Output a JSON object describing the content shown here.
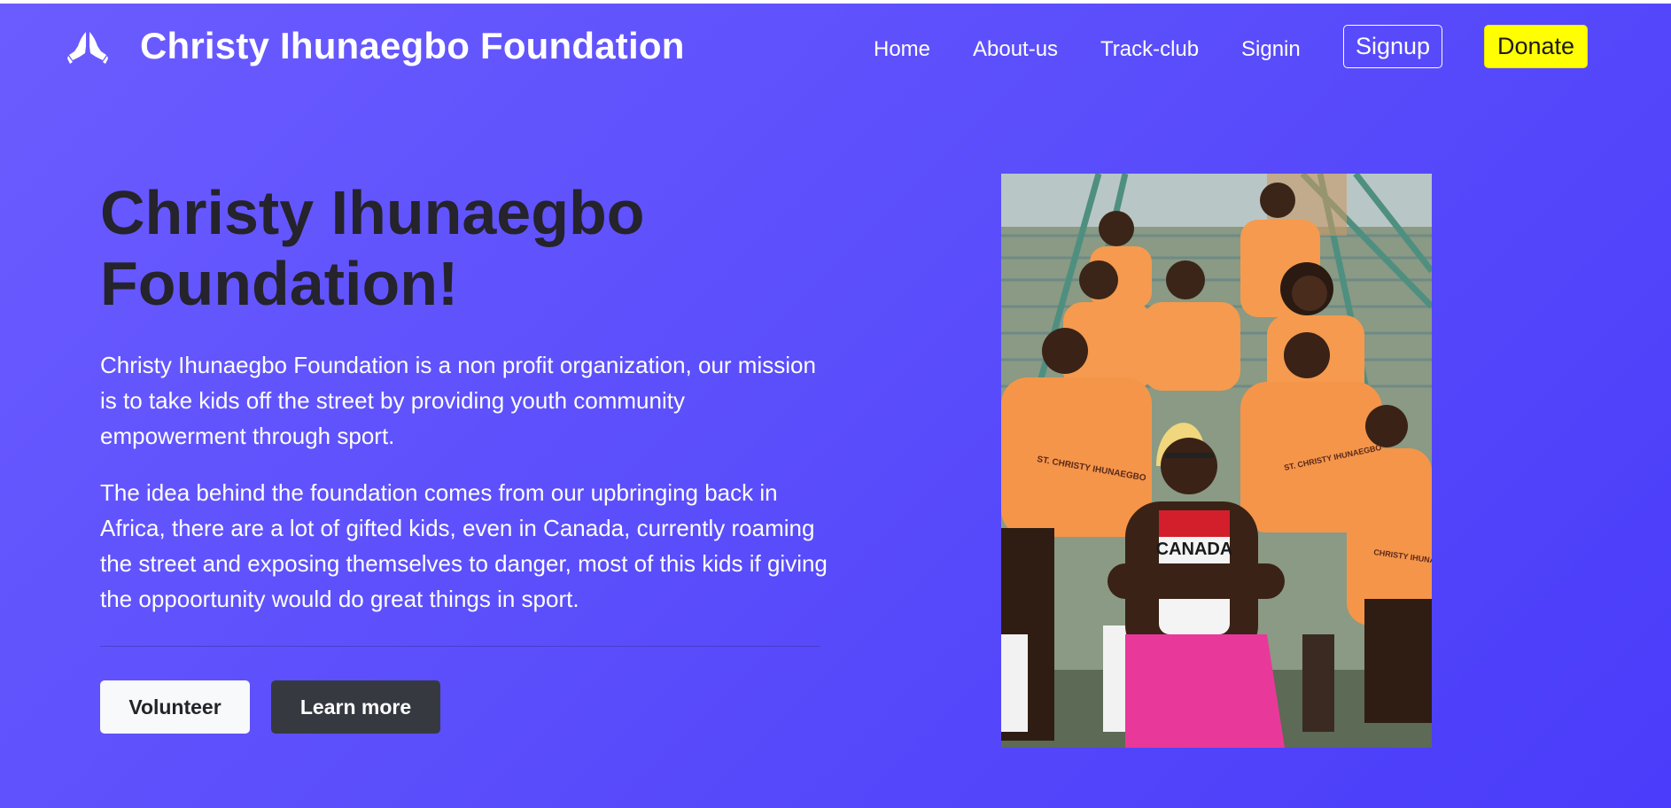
{
  "navbar": {
    "brand_icon": "praying-hands-icon",
    "brand_title": "Christy Ihunaegbo Foundation",
    "links": [
      "Home",
      "About-us",
      "Track-club",
      "Signin"
    ],
    "signup_label": "Signup",
    "donate_label": "Donate"
  },
  "hero": {
    "title": "Christy Ihunaegbo Foundation!",
    "paragraph_1": "Christy Ihunaegbo Foundation is a non profit organization, our mission is to take kids off the street by providing youth community empowerment through sport.",
    "paragraph_2": "The idea behind the foundation comes from our upbringing back in Africa, there are a lot of gifted kids, even in Canada, currently roaming the street and exposing themselves to danger, most of this kids if giving the oppoortunity would do great things in sport.",
    "volunteer_label": "Volunteer",
    "learn_more_label": "Learn more"
  },
  "photo": {
    "shirt_text": "ST. CHRISTY IHUNAEGBO ATHLETICS CLUB",
    "singlet_text": "CANADA"
  },
  "colors": {
    "background_start": "#6b5cff",
    "background_end": "#4a3cfa",
    "donate_bg": "#ffff00",
    "title_color": "#25232b",
    "learn_more_bg": "#363a40"
  }
}
